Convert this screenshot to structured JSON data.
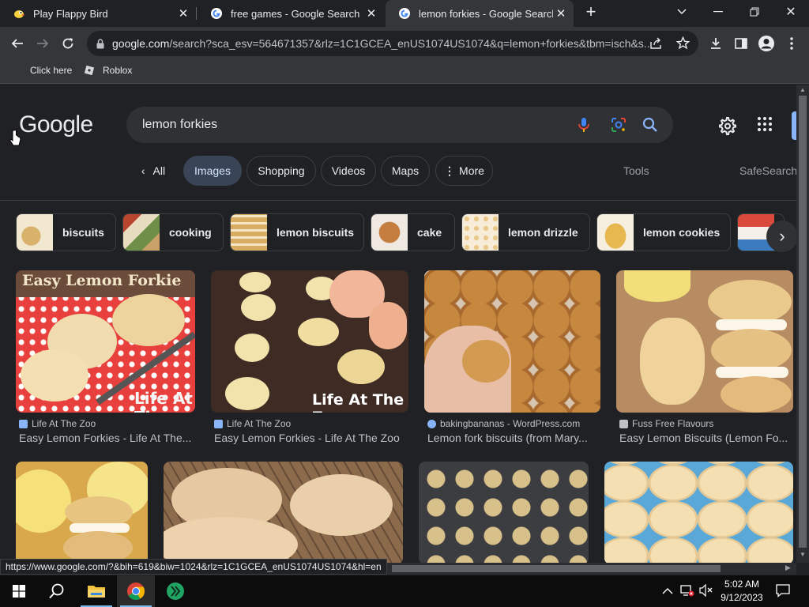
{
  "tabs": [
    {
      "title": "Play Flappy Bird",
      "active": false
    },
    {
      "title": "free games - Google Search",
      "active": false
    },
    {
      "title": "lemon forkies - Google Search",
      "active": true
    }
  ],
  "toolbar": {
    "url_domain": "google.com",
    "url_rest": "/search?sca_esv=564671357&rlz=1C1GCEA_enUS1074US1074&q=lemon+forkies&tbm=isch&s..."
  },
  "bookmarks": [
    {
      "label": "Click here"
    },
    {
      "label": "Roblox"
    }
  ],
  "header": {
    "logo": "Google",
    "query": "lemon forkies"
  },
  "nav": {
    "all": "All",
    "images": "Images",
    "shopping": "Shopping",
    "videos": "Videos",
    "maps": "Maps",
    "more": "More",
    "tools": "Tools",
    "safesearch": "SafeSearch"
  },
  "related": [
    {
      "label": "biscuits"
    },
    {
      "label": "cooking"
    },
    {
      "label": "lemon biscuits"
    },
    {
      "label": "cake"
    },
    {
      "label": "lemon drizzle"
    },
    {
      "label": "lemon cookies"
    }
  ],
  "results": [
    {
      "source": "Life At The Zoo",
      "caption": "Easy Lemon Forkies - Life At The..."
    },
    {
      "source": "Life At The Zoo",
      "caption": "Easy Lemon Forkies - Life At The Zoo"
    },
    {
      "source": "bakingbananas - WordPress.com",
      "caption": "Lemon fork biscuits (from Mary..."
    },
    {
      "source": "Fuss Free Flavours",
      "caption": "Easy Lemon Biscuits (Lemon Fo..."
    }
  ],
  "image_text": {
    "overlay1": "Easy Lemon Forkie",
    "watermark1": "Life At The",
    "watermark2": "Life At The Zoo"
  },
  "status_url": "https://www.google.com/?&bih=619&biw=1024&rlz=1C1GCEA_enUS1074US1074&hl=en",
  "clock": {
    "time": "5:02 AM",
    "date": "9/12/2023"
  },
  "colors": {
    "accent": "#8ab4f8",
    "selected_chip": "#394457",
    "background": "#202124"
  }
}
